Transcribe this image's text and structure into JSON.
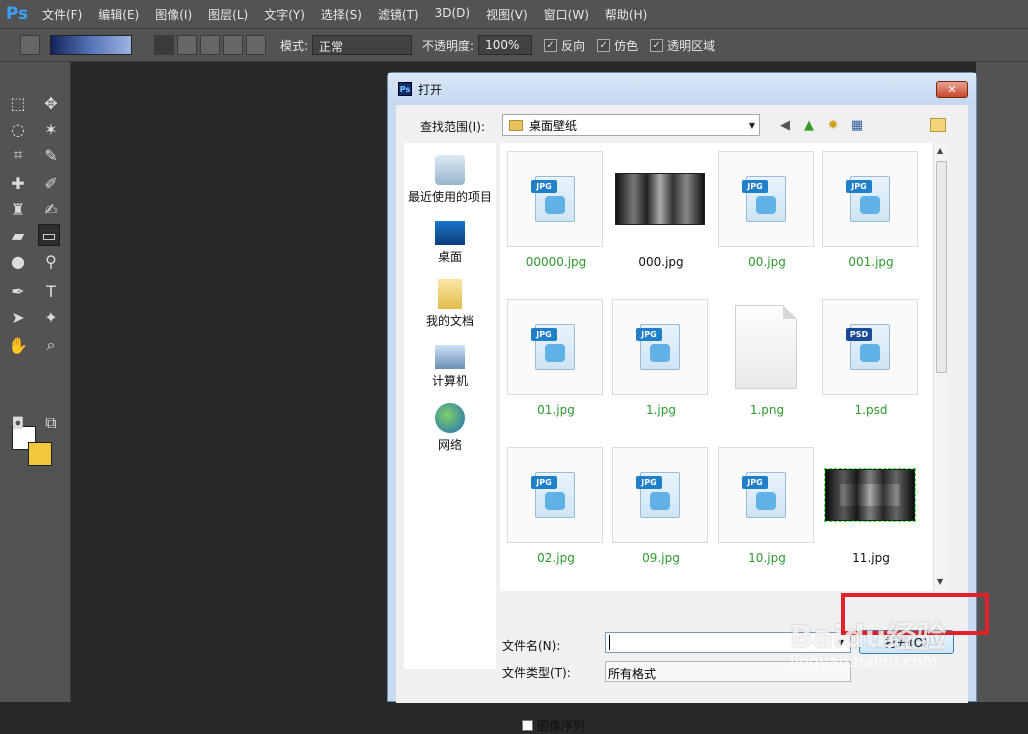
{
  "app": {
    "logo": "Ps",
    "brand_color": "#3aa0ff"
  },
  "menu": [
    "文件(F)",
    "编辑(E)",
    "图像(I)",
    "图层(L)",
    "文字(Y)",
    "选择(S)",
    "滤镜(T)",
    "3D(D)",
    "视图(V)",
    "窗口(W)",
    "帮助(H)"
  ],
  "options": {
    "mode_label": "模式:",
    "mode_value": "正常",
    "opacity_label": "不透明度:",
    "opacity_value": "100%",
    "reverse": "反向",
    "dither": "仿色",
    "transparency": "透明区域"
  },
  "colors": {
    "foreground": "#ffffff",
    "background": "#f0c93a"
  },
  "dialog": {
    "title": "打开",
    "close": "✕",
    "look_in_label": "查找范围(I):",
    "look_in_value": "桌面壁纸",
    "places": [
      "最近使用的项目",
      "桌面",
      "我的文档",
      "计算机",
      "网络"
    ],
    "files": [
      {
        "name": "00000.jpg",
        "type": "JPG"
      },
      {
        "name": "000.jpg",
        "type": "photo"
      },
      {
        "name": "00.jpg",
        "type": "JPG"
      },
      {
        "name": "001.jpg",
        "type": "JPG"
      },
      {
        "name": "01.jpg",
        "type": "JPG"
      },
      {
        "name": "1.jpg",
        "type": "JPG"
      },
      {
        "name": "1.png",
        "type": "PNG"
      },
      {
        "name": "1.psd",
        "type": "PSD"
      },
      {
        "name": "02.jpg",
        "type": "JPG"
      },
      {
        "name": "09.jpg",
        "type": "JPG"
      },
      {
        "name": "10.jpg",
        "type": "JPG"
      },
      {
        "name": "11.jpg",
        "type": "photo"
      }
    ],
    "filename_label": "文件名(N):",
    "filename_value": "",
    "filetype_label": "文件类型(T):",
    "filetype_value": "所有格式",
    "open_button": "打开(O)",
    "image_sequence": "图像序列"
  },
  "watermark": {
    "main": "Baidu经验",
    "sub": "jingyan.baidu.com"
  }
}
